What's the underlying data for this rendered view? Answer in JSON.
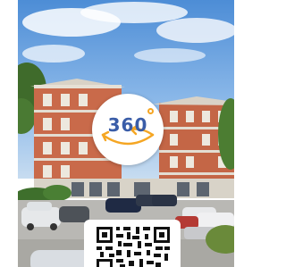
{
  "virtual_tour": {
    "badge_label": "360",
    "badge_color": "#3a5da8",
    "accent_color": "#f5a623"
  },
  "icons": {
    "badge_arrows": "rotate-arrows-icon",
    "degree": "degree-icon",
    "qr": "qr-code-icon"
  }
}
